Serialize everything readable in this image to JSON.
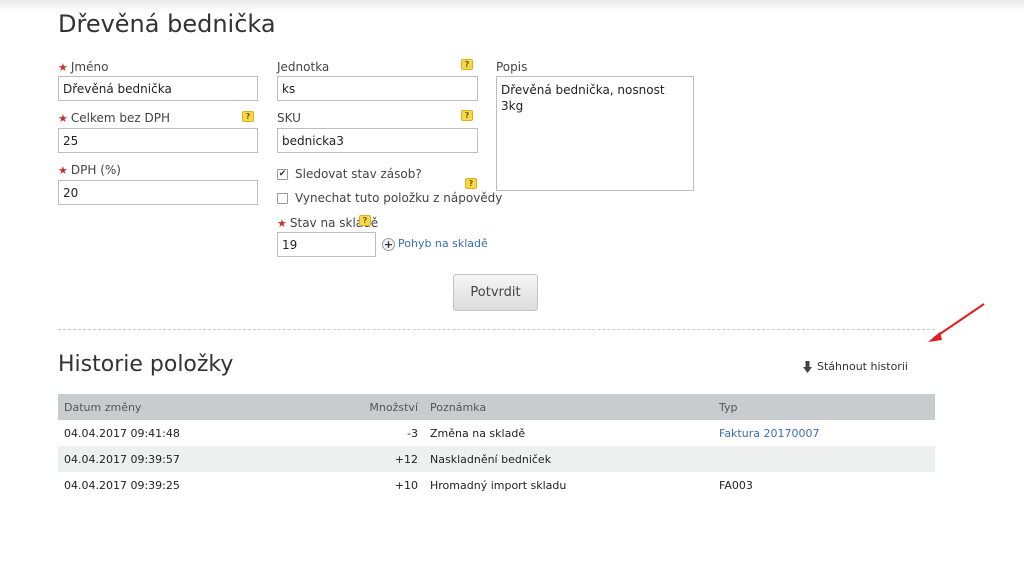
{
  "page": {
    "title": "Dřevěná bednička"
  },
  "form": {
    "name": {
      "label": "Jméno",
      "value": "Dřevěná bednička"
    },
    "total": {
      "label": "Celkem bez DPH",
      "value": "25"
    },
    "vat": {
      "label": "DPH (%)",
      "value": "20"
    },
    "unit": {
      "label": "Jednotka",
      "value": "ks"
    },
    "sku": {
      "label": "SKU",
      "value": "bednicka3"
    },
    "track_stock": {
      "label": "Sledovat stav zásob?",
      "checked": true
    },
    "exclude_hint": {
      "label": "Vynechat tuto položku z nápovědy",
      "checked": false
    },
    "stock": {
      "label": "Stav na skladě",
      "value": "19"
    },
    "stock_movement_link": "Pohyb na skladě",
    "description": {
      "label": "Popis",
      "value": "Dřevěná bednička, nosnost 3kg"
    },
    "submit_label": "Potvrdit",
    "help_glyph": "?",
    "required_glyph": "★",
    "check_glyph": "✔",
    "plus_glyph": "+"
  },
  "history": {
    "title": "Historie položky",
    "download_label": "Stáhnout historii",
    "columns": [
      "Datum změny",
      "Množství",
      "Poznámka",
      "Typ"
    ],
    "rows": [
      {
        "date": "04.04.2017 09:41:48",
        "qty": "-3",
        "note": "Změna na skladě",
        "type": "Faktura 20170007"
      },
      {
        "date": "04.04.2017 09:39:57",
        "qty": "+12",
        "note": "Naskladnění bedniček",
        "type": ""
      },
      {
        "date": "04.04.2017 09:39:25",
        "qty": "+10",
        "note": "Hromadný import skladu",
        "type": "FA003"
      }
    ]
  },
  "colors": {
    "accent_link": "#3a6fb0",
    "required": "#c9302c",
    "help_badge": "#f6d84a",
    "table_header": "#c9cccd",
    "annotation_arrow": "#e02020"
  }
}
